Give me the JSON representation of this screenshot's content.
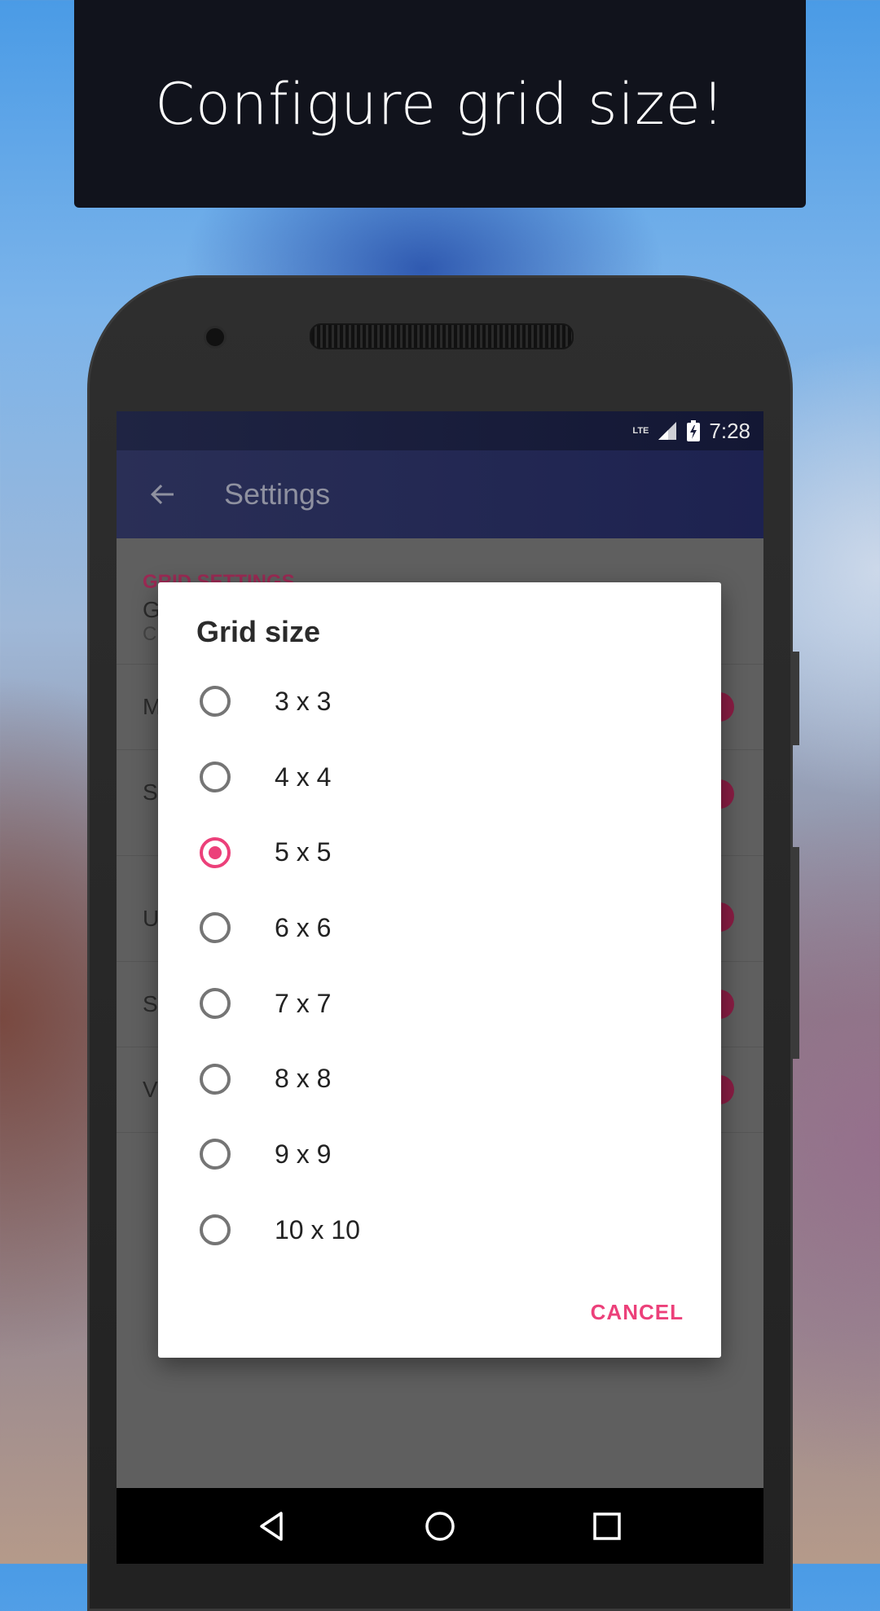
{
  "banner": {
    "title": "Configure grid size!"
  },
  "status_bar": {
    "network": "LTE",
    "time": "7:28"
  },
  "toolbar": {
    "title": "Settings"
  },
  "settings": {
    "section_header": "GRID SETTINGS",
    "rows": [
      {
        "title": "G",
        "subtitle": "Cl"
      },
      {
        "title": "M"
      },
      {
        "title": "S"
      },
      {
        "title": "U"
      },
      {
        "title": "S"
      },
      {
        "title": "V"
      }
    ]
  },
  "dialog": {
    "title": "Grid size",
    "options": [
      "3 x 3",
      "4 x 4",
      "5 x 5",
      "6 x 6",
      "7 x 7",
      "8 x 8",
      "9 x 9",
      "10 x 10"
    ],
    "selected": "5 x 5",
    "cancel_label": "CANCEL"
  },
  "colors": {
    "accent": "#ec407a",
    "primary": "#1d2250",
    "banner_bg": "#11131c"
  }
}
